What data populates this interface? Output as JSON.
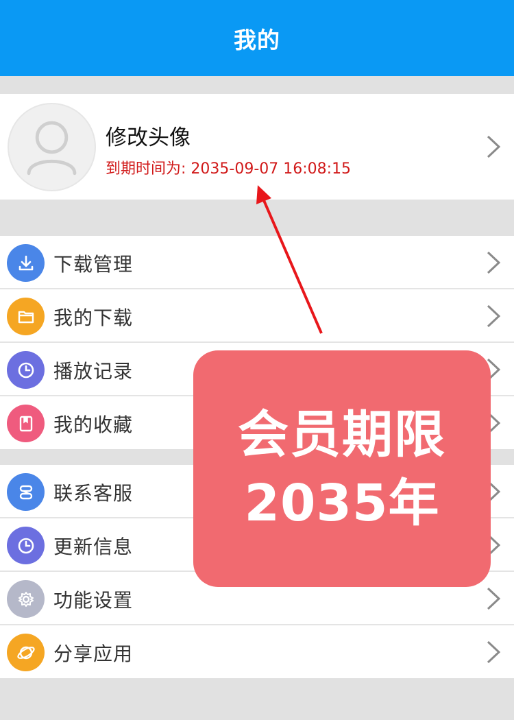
{
  "header": {
    "title": "我的"
  },
  "profile": {
    "name": "修改头像",
    "expiry": "到期时间为: 2035-09-07 16:08:15"
  },
  "menu_group_1": [
    {
      "label": "下载管理",
      "icon": "download-icon",
      "color": "#4a86e8"
    },
    {
      "label": "我的下载",
      "icon": "folder-icon",
      "color": "#f5a623"
    },
    {
      "label": "播放记录",
      "icon": "clock-icon",
      "color": "#6c6fe0"
    },
    {
      "label": "我的收藏",
      "icon": "bookmark-icon",
      "color": "#ef5b7e"
    }
  ],
  "menu_group_2": [
    {
      "label": "联系客服",
      "icon": "service-icon",
      "color": "#4a86e8"
    },
    {
      "label": "更新信息",
      "icon": "clock-icon",
      "color": "#6c6fe0"
    },
    {
      "label": "功能设置",
      "icon": "gear-icon",
      "color": "#b5b8c9"
    },
    {
      "label": "分享应用",
      "icon": "planet-icon",
      "color": "#f5a623"
    }
  ],
  "promo": {
    "line1": "会员期限",
    "line2": "2035年"
  },
  "colors": {
    "header": "#0a99f4",
    "expiry_text": "#d11a1a",
    "promo_bg": "#f16a70",
    "arrow": "#e8171b"
  }
}
